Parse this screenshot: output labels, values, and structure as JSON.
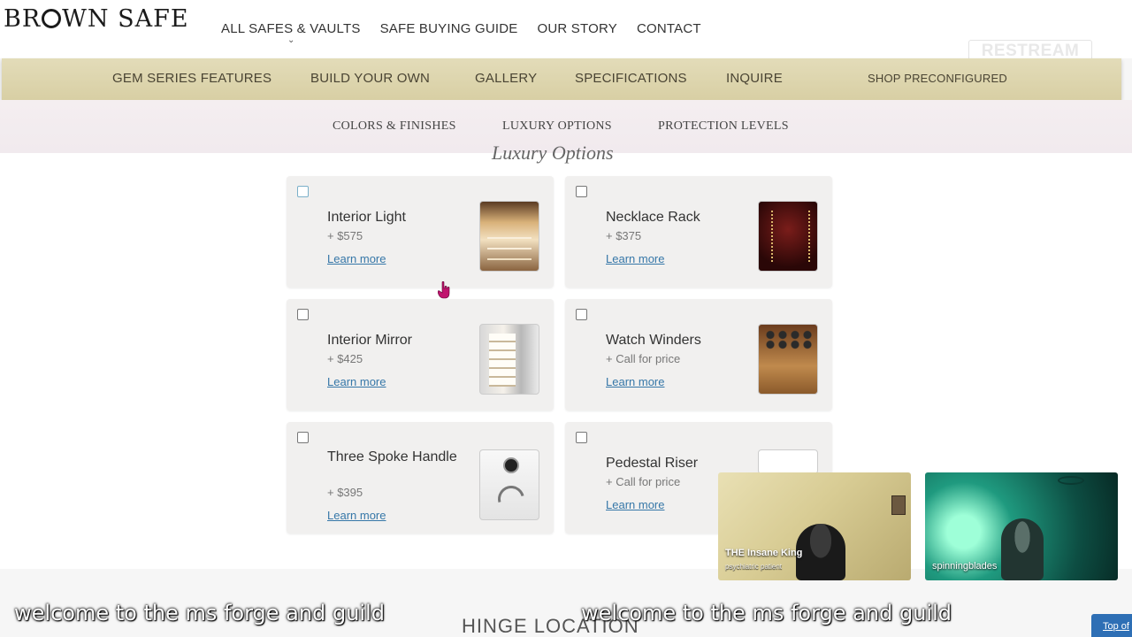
{
  "brand": {
    "logo_text": "BROWN SAFE",
    "logo_pre": "BR",
    "logo_post": "WN SAFE"
  },
  "top_nav": {
    "items": [
      "ALL SAFES & VAULTS",
      "SAFE BUYING GUIDE",
      "OUR STORY",
      "CONTACT"
    ]
  },
  "watermark": "RESTREAM",
  "sub_nav": {
    "items": [
      "GEM SERIES FEATURES",
      "BUILD YOUR OWN",
      "GALLERY",
      "SPECIFICATIONS",
      "INQUIRE"
    ],
    "shop_label": "SHOP PRECONFIGURED"
  },
  "section_tabs": [
    "COLORS & FINISHES",
    "LUXURY OPTIONS",
    "PROTECTION LEVELS"
  ],
  "section_title": "Luxury Options",
  "options": [
    {
      "name": "Interior Light",
      "price": "+ $575",
      "learn": "Learn more",
      "checked": false,
      "thumb": "interior-light-photo"
    },
    {
      "name": "Necklace Rack",
      "price": "+ $375",
      "learn": "Learn more",
      "checked": false,
      "thumb": "necklace-rack-photo"
    },
    {
      "name": "Interior Mirror",
      "price": "+ $425",
      "learn": "Learn more",
      "checked": false,
      "thumb": "interior-mirror-photo"
    },
    {
      "name": "Watch Winders",
      "price": "+ Call for price",
      "learn": "Learn more",
      "checked": false,
      "thumb": "watch-winders-photo"
    },
    {
      "name": "Three Spoke Handle",
      "price": "+ $395",
      "learn": "Learn more",
      "checked": false,
      "thumb": "three-spoke-handle-photo"
    },
    {
      "name": "Pedestal Riser",
      "price": "+ Call for price",
      "learn": "Learn more",
      "checked": false,
      "thumb": "pedestal-riser-photo"
    }
  ],
  "next_section_title": "HINGE LOCATION",
  "top_of_page": "Top of",
  "stream": {
    "cams": [
      {
        "name": "THE Insane King",
        "subtitle": "psychiatric patient"
      },
      {
        "name": "spinningblades",
        "subtitle": ""
      }
    ],
    "caption_left": "welcome to the ms forge and guild",
    "caption_right": "welcome to the ms forge and guild"
  },
  "colors": {
    "gold_nav": "#dcd3aa",
    "link_blue": "#3677a8",
    "card_bg": "#f1f0ef",
    "top_button": "#2e6fb5"
  }
}
